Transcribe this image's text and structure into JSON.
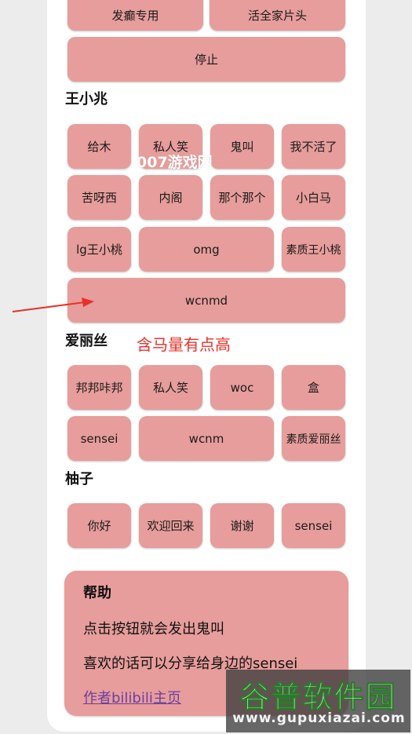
{
  "sections": {
    "top": {
      "buttons": [
        "发癫专用",
        "活全家片头",
        "停止"
      ]
    },
    "wangxiaozhao": {
      "title": "王小兆",
      "buttons": [
        "给木",
        "私人笑",
        "鬼叫",
        "我不活了",
        "苦呀西",
        "内阁",
        "那个那个",
        "小白马",
        "lg王小桃",
        "omg",
        "素质王小桃",
        "wcnmd"
      ]
    },
    "alice": {
      "title": "爱丽丝",
      "buttons": [
        "邦邦咔邦",
        "私人笑",
        "woc",
        "盒",
        "sensei",
        "wcnm",
        "素质爱丽丝"
      ]
    },
    "yuzu": {
      "title": "柚子",
      "buttons": [
        "你好",
        "欢迎回来",
        "谢谢",
        "sensei"
      ]
    }
  },
  "help": {
    "title": "帮助",
    "line1": "点击按钮就会发出鬼叫",
    "line2": "喜欢的话可以分享给身边的sensei",
    "link": "作者bilibili主页"
  },
  "overlays": {
    "watermark": "007游戏网",
    "annotation": "含马量有点高",
    "annotation_color": "#e8302a",
    "logo_title": "谷普软件园",
    "logo_url": "www.gupuxiazai.com"
  },
  "colors": {
    "button": "#e79d9b",
    "card": "#ffffff",
    "background": "#ececec",
    "link": "#6b3fa0"
  }
}
